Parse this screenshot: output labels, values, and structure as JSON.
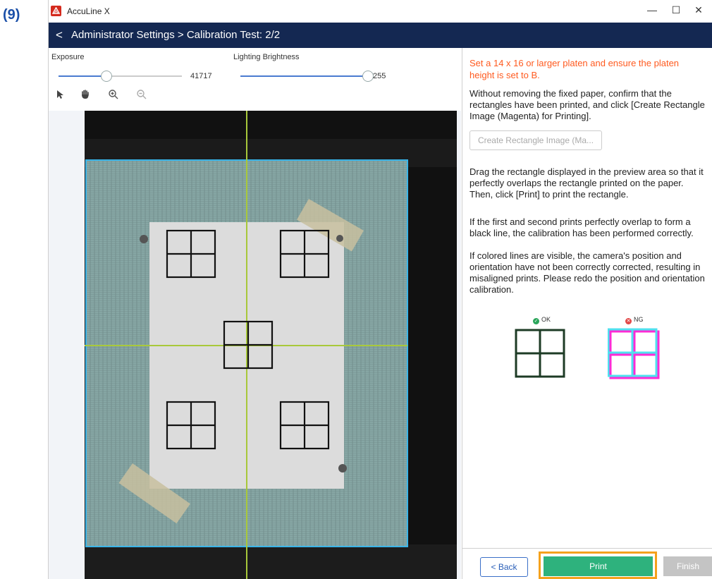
{
  "step_label": "(9)",
  "window": {
    "title": "AccuLine X",
    "controls": {
      "minimize": "—",
      "maximize": "☐",
      "close": "✕"
    }
  },
  "nav": {
    "back_icon": "<",
    "breadcrumb": "Administrator Settings > Calibration Test: 2/2"
  },
  "exposure": {
    "label": "Exposure",
    "value": "41717",
    "level": 0.38
  },
  "brightness": {
    "label": "Lighting Brightness",
    "value": "255",
    "level": 1.0
  },
  "tools": [
    "pointer-icon",
    "hand-icon",
    "zoom-in-icon",
    "zoom-out-icon"
  ],
  "panel": {
    "warning": "Set a 14 x 16 or larger platen and ensure the platen height is set to B.",
    "instruction1": "Without removing the fixed paper, confirm that the rectangles have been printed, and click [Create Rectangle Image (Magenta) for Printing].",
    "create_button": "Create Rectangle Image (Ma...",
    "instruction2": "Drag the rectangle displayed in the preview area so that it perfectly overlaps the rectangle printed on the paper. Then, click [Print] to print the rectangle.",
    "instruction3": "If the first and second prints perfectly overlap to form a black line, the calibration has been performed correctly.",
    "instruction4": "If colored lines are visible, the camera's position and orientation have not been correctly corrected, resulting in misaligned prints. Please redo the position and orientation calibration.",
    "ok_label": "OK",
    "ng_label": "NG"
  },
  "footer": {
    "back": "< Back",
    "print": "Print",
    "finish": "Finish"
  },
  "colors": {
    "nav_bg": "#142852",
    "warning": "#ff5a1f",
    "print": "#2eb27d",
    "highlight": "#f5a11c",
    "guide": "#a8c83a"
  }
}
